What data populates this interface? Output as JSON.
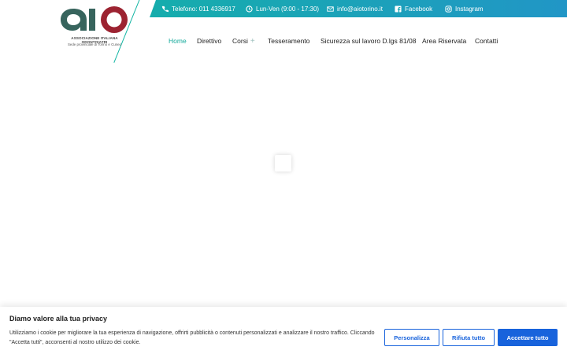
{
  "brand": {
    "logo_text": "aio",
    "line1": "ASSOCIAZIONE ITALIANA ODONTOIATRI",
    "line2": "Sede provinciale di Torino e Cuneo",
    "colors": {
      "a": "#37645d",
      "o": "#9c2331",
      "accent": "#12b5a3",
      "accent2": "#2196c6"
    }
  },
  "topbar": {
    "phone": {
      "icon": "phone-icon",
      "label": "Telefono: 011 4336917"
    },
    "hours": {
      "icon": "clock-icon",
      "label": "Lun-Ven (9:00 - 17:30)"
    },
    "email": {
      "icon": "mail-icon",
      "label": "info@aiotorino.it"
    },
    "facebook": {
      "icon": "facebook-icon",
      "label": "Facebook"
    },
    "instagram": {
      "icon": "instagram-icon",
      "label": "Instagram"
    }
  },
  "nav": {
    "items": [
      {
        "label": "Home"
      },
      {
        "label": "Direttivo"
      },
      {
        "label": "Corsi"
      },
      {
        "label": "Tesseramento"
      },
      {
        "label": "Sicurezza sul lavoro D.lgs 81/08"
      },
      {
        "label": "Area Riservata"
      },
      {
        "label": "Contatti"
      }
    ],
    "expand_symbol": "+"
  },
  "cookie": {
    "title": "Diamo valore alla tua privacy",
    "text": "Utilizziamo i cookie per migliorare la tua esperienza di navigazione, offrirti pubblicità o contenuti personalizzati e analizzare il nostro traffico. Cliccando \"Accetta tutti\", acconsenti al nostro utilizzo dei cookie.",
    "buttons": {
      "customize": "Personalizza",
      "reject": "Rifiuta tutto",
      "accept": "Accettare tutto"
    }
  }
}
